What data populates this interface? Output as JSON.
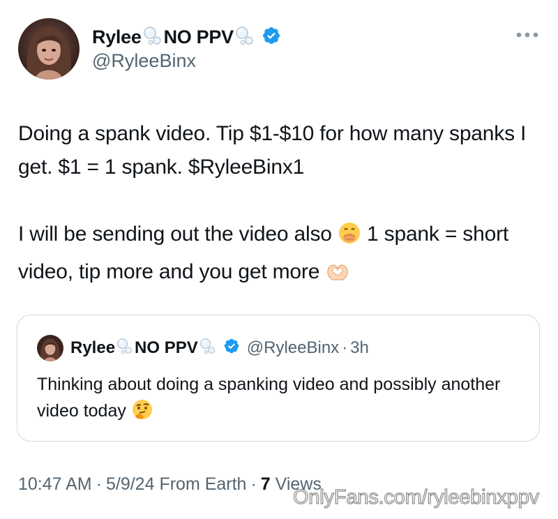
{
  "author": {
    "display_name_first": "Rylee",
    "display_name_second": "NO PPV",
    "handle": "@RyleeBinx",
    "verified_icon": "verified-badge-icon",
    "accent_color": "#1d9bf0"
  },
  "tweet": {
    "paragraph_1": "Doing a spank video. Tip $1-$10 for how many spanks I get. $1 = 1 spank. $RyleeBinx1",
    "paragraph_2_part_a": "I will be sending out the video also",
    "paragraph_2_part_b": "1 spank = short video, tip more and you get more",
    "emoji_1": "face-with-hand-over-mouth-emoji",
    "emoji_2": "heart-hands-emoji"
  },
  "quote": {
    "display_name_first": "Rylee",
    "display_name_second": "NO PPV",
    "handle": "@RyleeBinx",
    "dot": "·",
    "time": "3h",
    "text": "Thinking about doing a spanking video and possibly another video today",
    "emoji": "thinking-face-emoji"
  },
  "meta": {
    "time": "10:47 AM",
    "sep1": "·",
    "date": "5/9/24",
    "source": "From Earth",
    "sep2": "·",
    "views_count": "7",
    "views_label": "Views"
  },
  "watermark": "OnlyFans.com/ryleebinxppv"
}
